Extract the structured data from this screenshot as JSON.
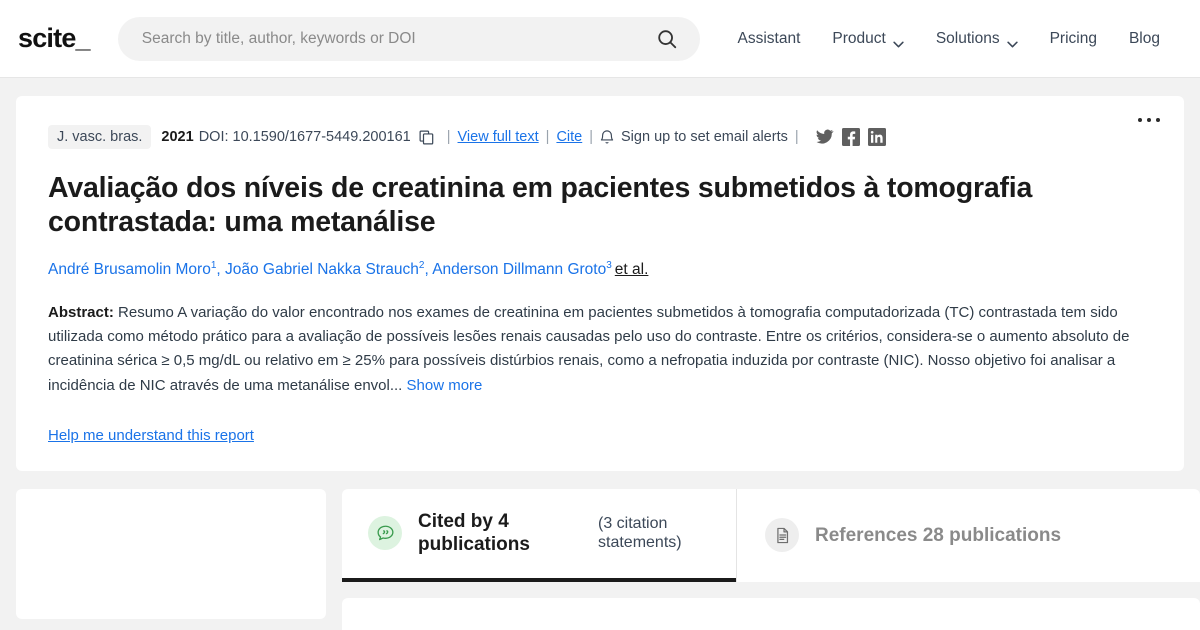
{
  "brand": {
    "logo": "scite_",
    "accent": "#1a73e8",
    "green": "#3a9b4e"
  },
  "header": {
    "search": {
      "placeholder": "Search by title, author, keywords or DOI",
      "value": "",
      "icon": "search-icon"
    },
    "nav": [
      {
        "label": "Assistant",
        "has_dropdown": false
      },
      {
        "label": "Product",
        "has_dropdown": true
      },
      {
        "label": "Solutions",
        "has_dropdown": true
      },
      {
        "label": "Pricing",
        "has_dropdown": false
      },
      {
        "label": "Blog",
        "has_dropdown": false
      }
    ]
  },
  "article": {
    "journal": "J. vasc. bras.",
    "year": "2021",
    "doi_label": "DOI: 10.1590/1677-5449.200161",
    "copy_icon": "copy-icon",
    "view_full_text": "View full text",
    "cite": "Cite",
    "alerts_icon": "bell-icon",
    "alerts": "Sign up to set email alerts",
    "separator": "|",
    "social": [
      {
        "name": "twitter-icon",
        "label": "Twitter"
      },
      {
        "name": "facebook-icon",
        "label": "Facebook"
      },
      {
        "name": "linkedin-icon",
        "label": "LinkedIn"
      }
    ],
    "title": "Avaliação dos níveis de creatinina em pacientes submetidos à tomografia contrastada: uma metanálise",
    "authors": [
      {
        "name": "André Brusamolin Moro",
        "affiliation": "1"
      },
      {
        "name": "João Gabriel Nakka Strauch",
        "affiliation": "2"
      },
      {
        "name": "Anderson Dillmann Groto",
        "affiliation": "3"
      }
    ],
    "et_al": "et al.",
    "abstract_label": "Abstract:",
    "abstract_text": "Resumo A variação do valor encontrado nos exames de creatinina em pacientes submetidos à tomografia computadorizada (TC) contrastada tem sido utilizada como método prático para a avaliação de possíveis lesões renais causadas pelo uso do contraste. Entre os critérios, considera-se o aumento absoluto de creatinina sérica ≥ 0,5 mg/dL ou relativo em ≥ 25% para possíveis distúrbios renais, como a nefropatia induzida por contraste (NIC). Nosso objetivo foi analisar a incidência de NIC através de uma metanálise envol...",
    "show_more": "Show more",
    "help_link": "Help me understand this report",
    "more_menu": "kebab-menu"
  },
  "tabs": [
    {
      "id": "cited-by",
      "icon": "citation-bubble-icon",
      "label": "Cited by 4 publications",
      "sub": "(3 citation statements)",
      "active": true
    },
    {
      "id": "references",
      "icon": "document-icon",
      "label": "References 28 publications",
      "sub": "",
      "active": false
    }
  ]
}
